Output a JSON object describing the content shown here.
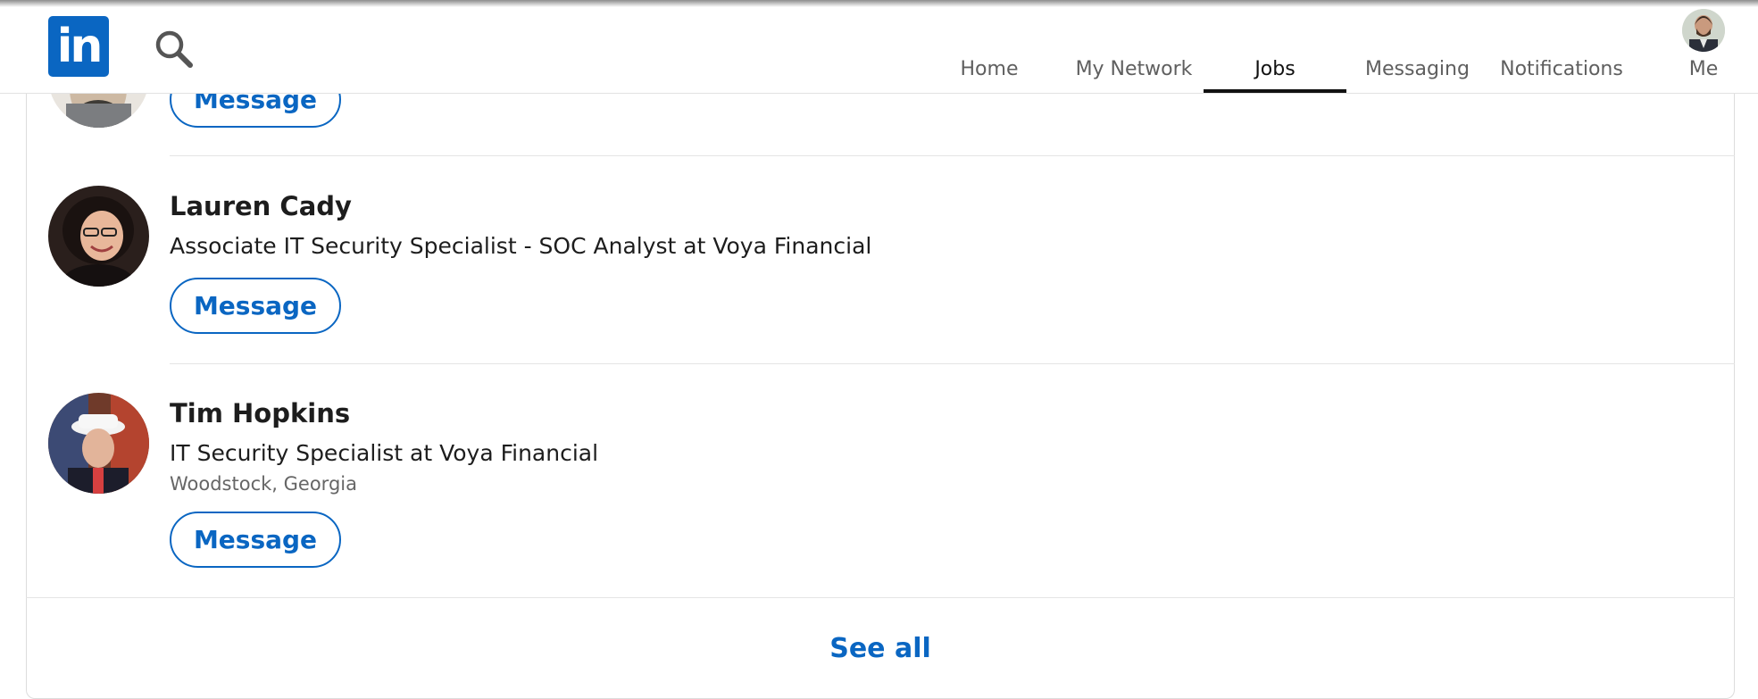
{
  "nav": {
    "logo_text": "in",
    "items": [
      {
        "label": "Home"
      },
      {
        "label": "My Network"
      },
      {
        "label": "Jobs"
      },
      {
        "label": "Messaging"
      },
      {
        "label": "Notifications"
      },
      {
        "label": "Me"
      }
    ],
    "active": "Jobs",
    "icons": {
      "search": "search-icon",
      "profile": "me-avatar"
    }
  },
  "people": [
    {
      "name": "",
      "headline": "",
      "location": "",
      "message_label": "Message"
    },
    {
      "name": "Lauren Cady",
      "headline": "Associate IT Security Specialist - SOC Analyst at Voya Financial",
      "location": "",
      "message_label": "Message"
    },
    {
      "name": "Tim Hopkins",
      "headline": "IT Security Specialist at Voya Financial",
      "location": "Woodstock, Georgia",
      "message_label": "Message"
    }
  ],
  "footer": {
    "see_all_label": "See all"
  },
  "colors": {
    "brand": "#0a66c2",
    "text": "#1d1d1d",
    "muted": "#666666"
  }
}
